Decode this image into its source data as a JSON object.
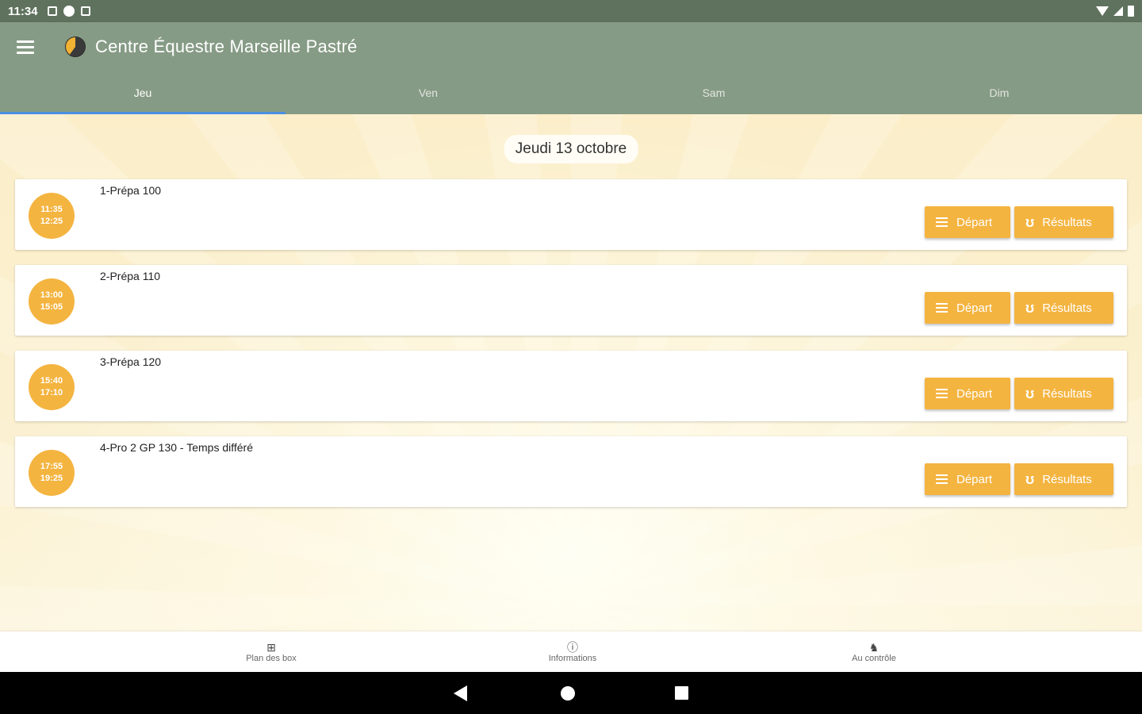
{
  "status_bar": {
    "time": "11:34"
  },
  "app_bar": {
    "title": "Centre Équestre Marseille Pastré"
  },
  "tabs": [
    {
      "label": "Jeu",
      "active": true
    },
    {
      "label": "Ven",
      "active": false
    },
    {
      "label": "Sam",
      "active": false
    },
    {
      "label": "Dim",
      "active": false
    }
  ],
  "main": {
    "date_label": "Jeudi 13 octobre",
    "events": [
      {
        "title": "1-Prépa 100",
        "start": "11:35",
        "end": "12:25",
        "depart_label": "Départ",
        "results_label": "Résultats"
      },
      {
        "title": "2-Prépa 110",
        "start": "13:00",
        "end": "15:05",
        "depart_label": "Départ",
        "results_label": "Résultats"
      },
      {
        "title": "3-Prépa 120",
        "start": "15:40",
        "end": "17:10",
        "depart_label": "Départ",
        "results_label": "Résultats"
      },
      {
        "title": "4-Pro 2 GP 130 - Temps différé",
        "start": "17:55",
        "end": "19:25",
        "depart_label": "Départ",
        "results_label": "Résultats"
      }
    ]
  },
  "bottom_nav": [
    {
      "label": "Plan des box",
      "icon": "grid-icon"
    },
    {
      "label": "Informations",
      "icon": "info-icon"
    },
    {
      "label": "Au contrôle",
      "icon": "horse-icon"
    }
  ],
  "colors": {
    "app_bar": "#869b85",
    "status_bar": "#5f725e",
    "accent": "#f4b440",
    "tab_indicator": "#4a90e2"
  }
}
